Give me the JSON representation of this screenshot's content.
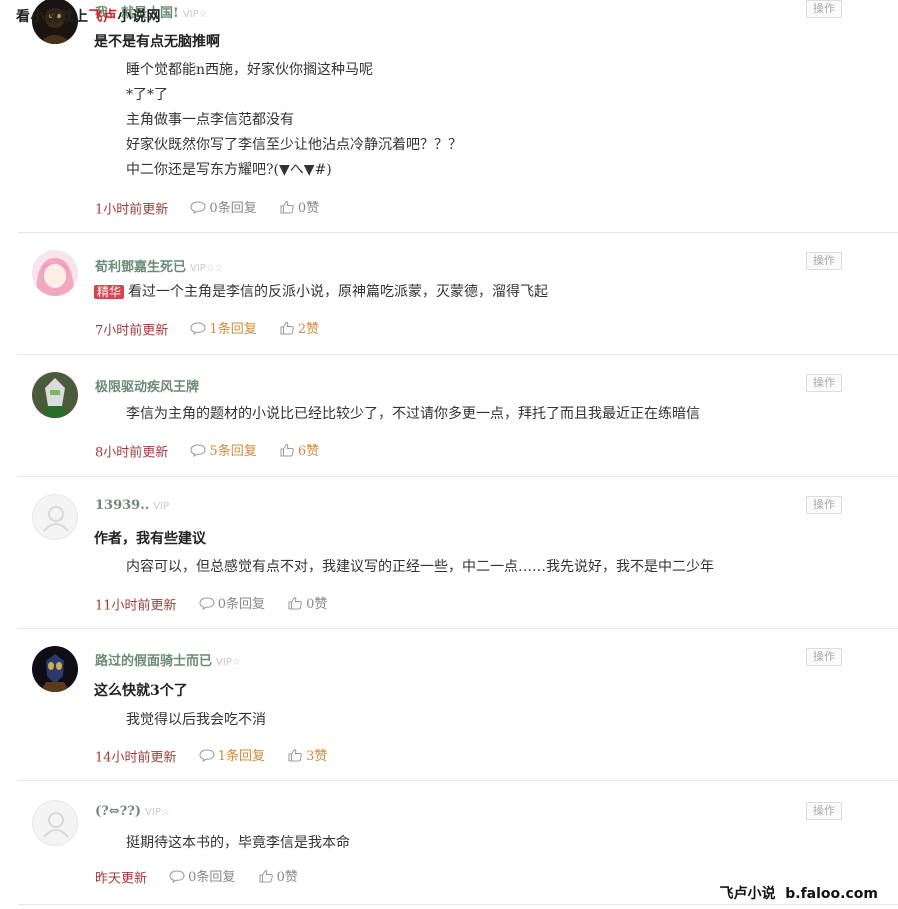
{
  "watermark": {
    "prefix": "看小说就上",
    "brand": "飞卢",
    "suffix": "小说网"
  },
  "footer": {
    "brand": "飞卢小说",
    "domain": "b.faloo.com"
  },
  "ops_label": "操作",
  "comments": [
    {
      "user": "我，就是大国!",
      "vip": "VIP☆",
      "title": "是不是有点无脑推啊",
      "lines": [
        "睡个觉都能n西施，好家伙你搁这种马呢",
        "*了*了",
        "主角做事一点李信范都没有",
        "好家伙既然你写了李信至少让他沾点冷静沉着吧？？？",
        "中二你还是写东方耀吧?(▼へ▼#)"
      ],
      "time": "1小时前更新",
      "reply": "0条回复",
      "like": "0赞"
    },
    {
      "user": "荀利鄧嘉生死已",
      "vip": "VIP☆☆",
      "badge": "精华",
      "lines": [
        "看过一个主角是李信的反派小说，原神篇吃派蒙，灭蒙德，溜得飞起"
      ],
      "time": "7小时前更新",
      "reply": "1条回复",
      "like": "2赞"
    },
    {
      "user": "极限驱动疾风王牌",
      "vip": "",
      "lines": [
        "李信为主角的题材的小说比已经比较少了，不过请你多更一点，拜托了而且我最近正在练暗信"
      ],
      "time": "8小时前更新",
      "reply": "5条回复",
      "like": "6赞"
    },
    {
      "user": "13939..",
      "vip": "VIP",
      "title": "作者，我有些建议",
      "lines": [
        "内容可以，但总感觉有点不对，我建议写的正经一些，中二一点……我先说好，我不是中二少年"
      ],
      "time": "11小时前更新",
      "reply": "0条回复",
      "like": "0赞"
    },
    {
      "user": "路过的假面骑士而已",
      "vip": "VIP☆",
      "title": "这么快就3个了",
      "lines": [
        "我觉得以后我会吃不消"
      ],
      "time": "14小时前更新",
      "reply": "1条回复",
      "like": "3赞"
    },
    {
      "user": "(?⇔??)",
      "vip": "VIP☆",
      "lines": [
        "挺期待这本书的，毕竟李信是我本命"
      ],
      "time": "昨天更新",
      "reply": "0条回复",
      "like": "0赞"
    }
  ]
}
